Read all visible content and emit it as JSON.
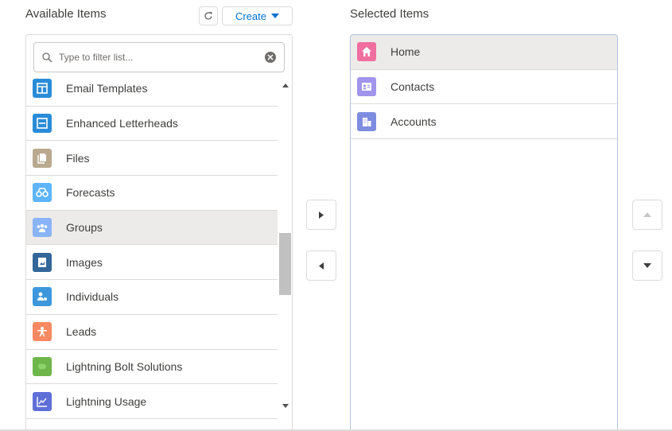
{
  "available": {
    "label": "Available Items",
    "create_label": "Create",
    "search_placeholder": "Type to filter list...",
    "items": [
      {
        "label": "Email Templates",
        "icon": "email-template-icon",
        "color": "#2a8bd8"
      },
      {
        "label": "Enhanced Letterheads",
        "icon": "letterhead-icon",
        "color": "#2a8bd8"
      },
      {
        "label": "Files",
        "icon": "files-icon",
        "color": "#b9a98f"
      },
      {
        "label": "Forecasts",
        "icon": "forecasts-icon",
        "color": "#5eb4ff"
      },
      {
        "label": "Groups",
        "icon": "groups-icon",
        "color": "#8ab4f8",
        "highlighted": true
      },
      {
        "label": "Images",
        "icon": "images-icon",
        "color": "#336699"
      },
      {
        "label": "Individuals",
        "icon": "individuals-icon",
        "color": "#3c97dd"
      },
      {
        "label": "Leads",
        "icon": "leads-icon",
        "color": "#f88962"
      },
      {
        "label": "Lightning Bolt Solutions",
        "icon": "lightning-bolt-icon",
        "color": "#6eb64a"
      },
      {
        "label": "Lightning Usage",
        "icon": "lightning-usage-icon",
        "color": "#5e6fd8"
      }
    ]
  },
  "selected": {
    "label": "Selected Items",
    "items": [
      {
        "label": "Home",
        "icon": "home-icon",
        "color": "#ef6e9f",
        "highlighted": true
      },
      {
        "label": "Contacts",
        "icon": "contacts-icon",
        "color": "#a094ed"
      },
      {
        "label": "Accounts",
        "icon": "accounts-icon",
        "color": "#7f8de1"
      }
    ]
  }
}
